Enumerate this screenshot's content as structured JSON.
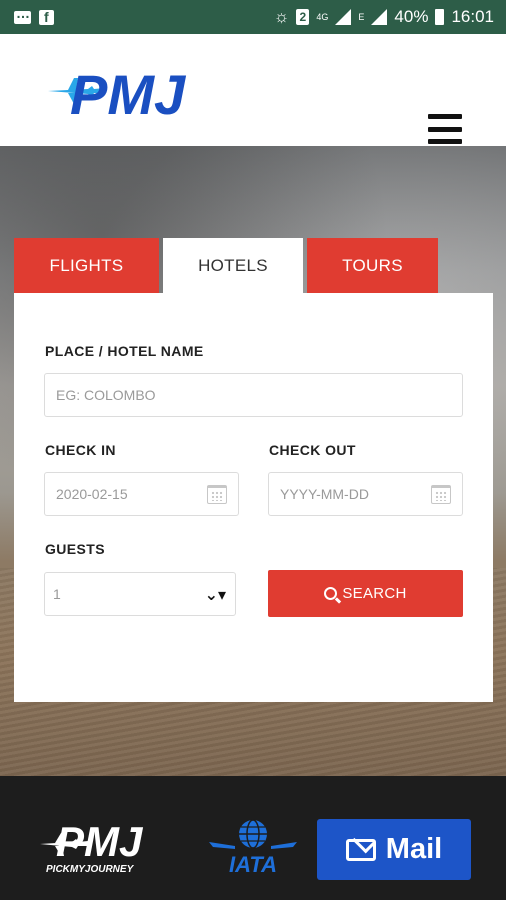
{
  "status_bar": {
    "network_label": "4G",
    "roaming_label": "E",
    "battery": "40%",
    "time": "16:01",
    "sim_badge": "2"
  },
  "header": {
    "logo_text": "PMJ",
    "brand_color": "#1a4fc1",
    "accent_color": "#2aa7e8"
  },
  "tabs": [
    {
      "label": "FLIGHTS",
      "active": false
    },
    {
      "label": "HOTELS",
      "active": true
    },
    {
      "label": "TOURS",
      "active": false
    }
  ],
  "form": {
    "place_label": "PLACE / HOTEL NAME",
    "place_placeholder": "EG: COLOMBO",
    "checkin_label": "CHECK IN",
    "checkin_value": "2020-02-15",
    "checkout_label": "CHECK OUT",
    "checkout_placeholder": "YYYY-MM-DD",
    "guests_label": "GUESTS",
    "guests_value": "1",
    "search_label": "SEARCH"
  },
  "footer": {
    "logo_text": "PMJ",
    "logo_subtext": "PICKMYJOURNEY",
    "iata_text": "IATA",
    "mail_label": "Mail"
  },
  "colors": {
    "accent_red": "#e03c31",
    "status_bar": "#2d5d48",
    "mail_button": "#1d55c8",
    "footer_bg": "#1d1d1d"
  }
}
